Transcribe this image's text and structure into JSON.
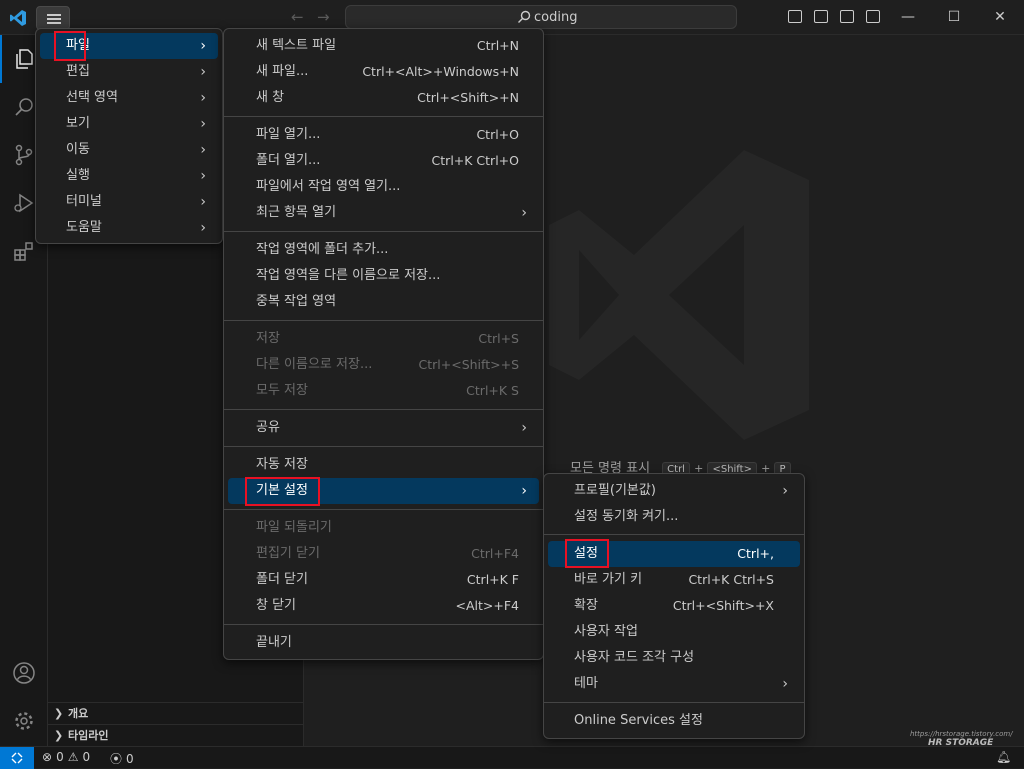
{
  "titlebar": {
    "search_text": "coding",
    "nav_back": "←",
    "nav_forward": "→",
    "window_min": "—",
    "window_max": "☐",
    "window_close": "✕"
  },
  "sidebar": {
    "sections": [
      "개요",
      "타임라인"
    ]
  },
  "editor": {
    "command_hint": "모든 명령 표시",
    "command_keys": [
      "Ctrl",
      "+",
      "<Shift>",
      "+",
      "P"
    ]
  },
  "status": {
    "errors": "0",
    "warnings": "0",
    "ports": "0"
  },
  "menus": {
    "main": [
      {
        "label": "파일"
      },
      {
        "label": "편집"
      },
      {
        "label": "선택 영역"
      },
      {
        "label": "보기"
      },
      {
        "label": "이동"
      },
      {
        "label": "실행"
      },
      {
        "label": "터미널"
      },
      {
        "label": "도움말"
      }
    ],
    "file": [
      {
        "label": "새 텍스트 파일",
        "key": "Ctrl+N"
      },
      {
        "label": "새 파일...",
        "key": "Ctrl+<Alt>+Windows+N"
      },
      {
        "label": "새 창",
        "key": "Ctrl+<Shift>+N"
      },
      {
        "label": "파일 열기...",
        "key": "Ctrl+O"
      },
      {
        "label": "폴더 열기...",
        "key": "Ctrl+K Ctrl+O"
      },
      {
        "label": "파일에서 작업 영역 열기...",
        "key": ""
      },
      {
        "label": "최근 항목 열기",
        "key": ""
      },
      {
        "label": "작업 영역에 폴더 추가...",
        "key": ""
      },
      {
        "label": "작업 영역을 다른 이름으로 저장...",
        "key": ""
      },
      {
        "label": "중복 작업 영역",
        "key": ""
      },
      {
        "label": "저장",
        "key": "Ctrl+S"
      },
      {
        "label": "다른 이름으로 저장...",
        "key": "Ctrl+<Shift>+S"
      },
      {
        "label": "모두 저장",
        "key": "Ctrl+K S"
      },
      {
        "label": "공유",
        "key": ""
      },
      {
        "label": "자동 저장",
        "key": ""
      },
      {
        "label": "기본 설정",
        "key": ""
      },
      {
        "label": "파일 되돌리기",
        "key": ""
      },
      {
        "label": "편집기 닫기",
        "key": "Ctrl+F4"
      },
      {
        "label": "폴더 닫기",
        "key": "Ctrl+K F"
      },
      {
        "label": "창 닫기",
        "key": "<Alt>+F4"
      },
      {
        "label": "끝내기",
        "key": ""
      }
    ],
    "prefs": [
      {
        "label": "프로필(기본값)",
        "key": ""
      },
      {
        "label": "설정 동기화 켜기...",
        "key": ""
      },
      {
        "label": "설정",
        "key": "Ctrl+,"
      },
      {
        "label": "바로 가기 키",
        "key": "Ctrl+K Ctrl+S"
      },
      {
        "label": "확장",
        "key": "Ctrl+<Shift>+X"
      },
      {
        "label": "사용자 작업",
        "key": ""
      },
      {
        "label": "사용자 코드 조각 구성",
        "key": ""
      },
      {
        "label": "테마",
        "key": ""
      },
      {
        "label": "Online Services 설정",
        "key": ""
      }
    ]
  },
  "watermark": {
    "line1": "https://hrstorage.tistory.com/",
    "line2": "HR STORAGE"
  },
  "colors": {
    "accent": "#0078d4",
    "highlight": "#04395e",
    "annotation_box": "#e81123"
  }
}
